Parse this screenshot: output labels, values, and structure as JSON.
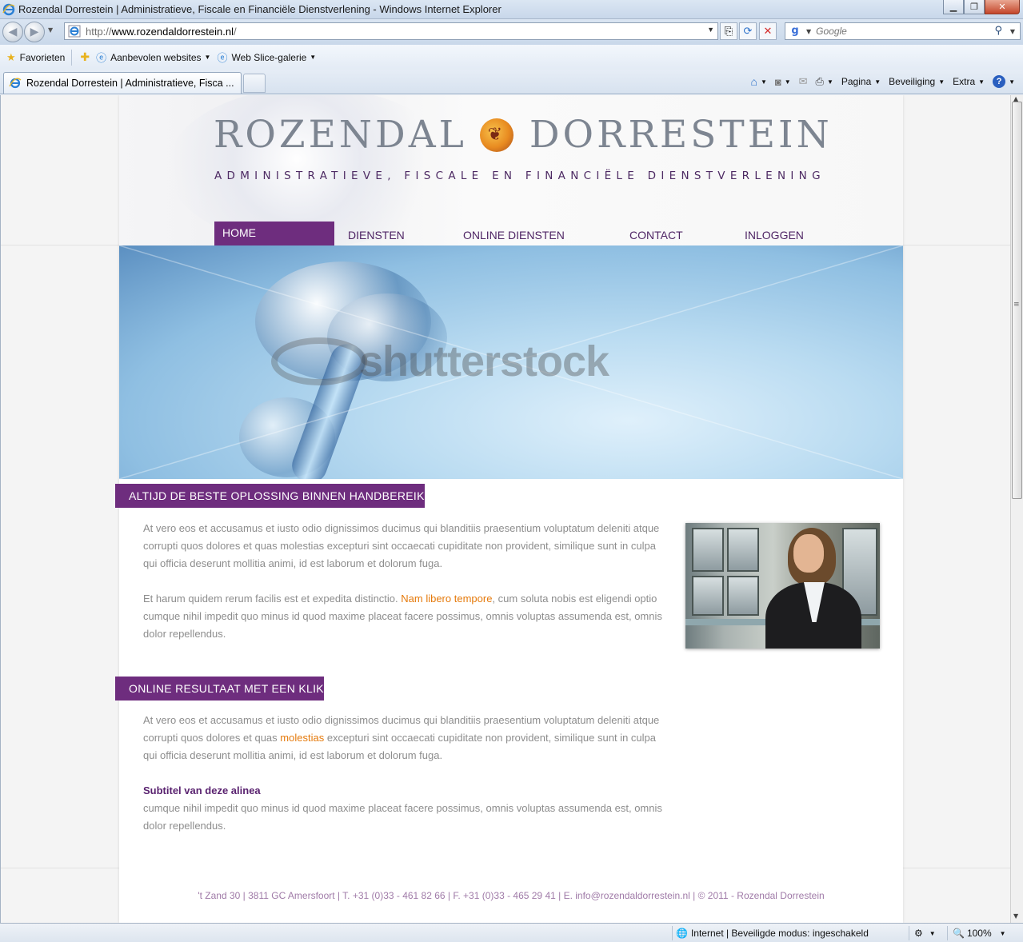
{
  "browser": {
    "window_title": "Rozendal Dorrestein |  Administratieve, Fiscale en Financiële Dienstverlening  - Windows Internet Explorer",
    "address": {
      "prefix": "http://",
      "host": "www.rozendaldorrestein.nl",
      "suffix": "/"
    },
    "search_placeholder": "Google",
    "favorites_label": "Favorieten",
    "fav_links": [
      "Aanbevolen websites",
      "Web Slice-galerie"
    ],
    "tab_title": "Rozendal Dorrestein |  Administratieve, Fisca ...",
    "commands": {
      "page": "Pagina",
      "security": "Beveiliging",
      "extra": "Extra"
    },
    "status": {
      "zone": "Internet | Beveiligde modus: ingeschakeld",
      "zoom": "100%"
    }
  },
  "site": {
    "logo_left": "ROZENDAL",
    "logo_right": "DORRESTEIN",
    "tagline": "ADMINISTRATIEVE, FISCALE EN FINANCIËLE DIENSTVERLENING",
    "menu": [
      "HOME",
      "DIENSTEN",
      "ONLINE DIENSTEN",
      "CONTACT",
      "INLOGGEN"
    ],
    "banner_watermark": "shutterstock",
    "section1": {
      "title": "ALTIJD DE BESTE OPLOSSING BINNEN HANDBEREIK",
      "p1": "At vero eos et accusamus et iusto odio dignissimos ducimus qui blanditiis praesentium voluptatum deleniti atque corrupti quos dolores et quas molestias excepturi sint occaecati cupiditate non provident, similique sunt in culpa qui officia deserunt mollitia animi, id est laborum et dolorum fuga.",
      "p2_before": "Et harum quidem rerum facilis est et expedita distinctio. ",
      "p2_link": "Nam libero tempore",
      "p2_after": ", cum soluta nobis est eligendi optio cumque nihil impedit quo minus id quod maxime placeat facere possimus, omnis voluptas assumenda est, omnis dolor repellendus."
    },
    "section2": {
      "title": "ONLINE RESULTAAT MET EEN KLIK",
      "p1_before": "At vero eos et accusamus et iusto odio dignissimos ducimus qui blanditiis praesentium voluptatum deleniti atque corrupti quos dolores et quas ",
      "p1_link": "molestias",
      "p1_after": " excepturi sint occaecati cupiditate non provident, similique sunt in culpa qui officia deserunt mollitia animi, id est laborum et dolorum fuga.",
      "subtitle": "Subtitel van deze alinea",
      "p2": "cumque nihil impedit quo minus id quod maxime placeat facere possimus, omnis voluptas assumenda est, omnis dolor repellendus."
    },
    "footer": "'t Zand 30 | 3811 GC Amersfoort | T. +31 (0)33 - 461 82 66 | F. +31 (0)33 - 465 29 41 | E. info@rozendaldorrestein.nl | © 2011 - Rozendal Dorrestein"
  },
  "colors": {
    "brand_purple": "#6e2d7e",
    "link_orange": "#e57a0c",
    "body_text": "#8d8d8d"
  }
}
